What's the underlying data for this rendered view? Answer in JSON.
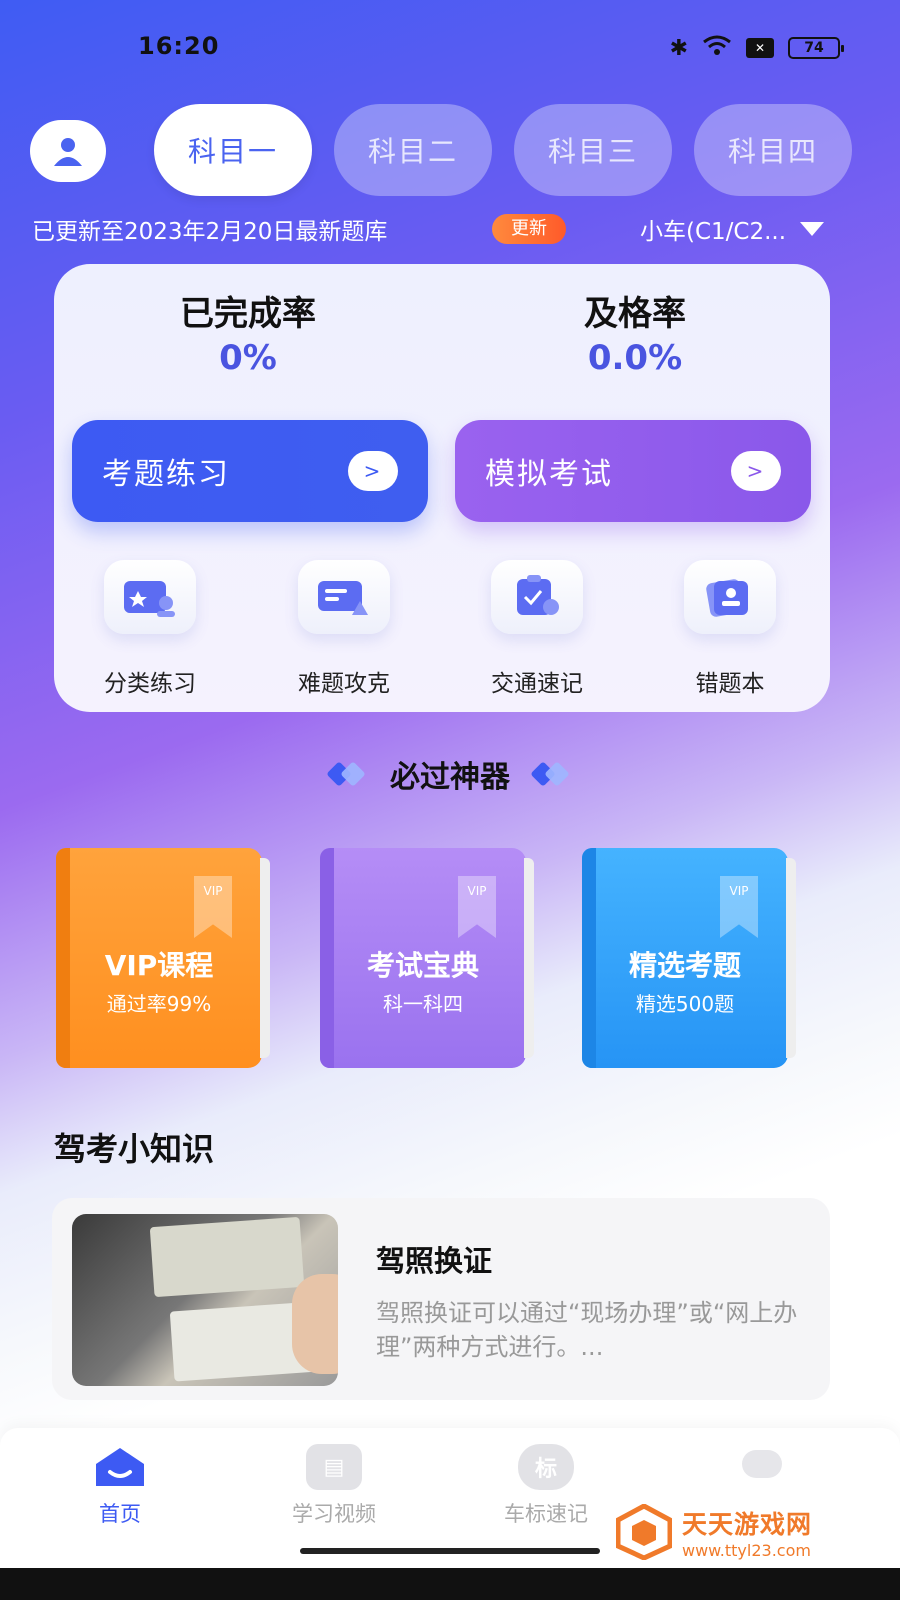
{
  "status": {
    "time": "16:20",
    "battery": "74",
    "icons": [
      "bluetooth-icon",
      "wifi-icon",
      "sim-icon",
      "battery-icon"
    ]
  },
  "header": {
    "avatar_icon": "user-icon",
    "tabs": [
      {
        "label": "科目一",
        "active": true
      },
      {
        "label": "科目二",
        "active": false
      },
      {
        "label": "科目三",
        "active": false
      },
      {
        "label": "科目四",
        "active": false
      }
    ],
    "update_text": "已更新至2023年2月20日最新题库",
    "update_badge": "更新",
    "car_type": "小车(C1/C2..."
  },
  "stats": {
    "completion_label": "已完成率",
    "completion_value": "0%",
    "pass_label": "及格率",
    "pass_value": "0.0%"
  },
  "actions": {
    "practice_label": "考题练习",
    "exam_label": "模拟考试",
    "arrow": ">"
  },
  "tools": [
    {
      "label": "分类练习",
      "icon": "category-icon"
    },
    {
      "label": "难题攻克",
      "icon": "difficult-icon"
    },
    {
      "label": "交通速记",
      "icon": "traffic-icon"
    },
    {
      "label": "错题本",
      "icon": "mistake-book-icon"
    }
  ],
  "section": {
    "title": "必过神器"
  },
  "books": [
    {
      "title": "VIP课程",
      "subtitle": "通过率99%",
      "tag": "VIP",
      "color": "#ff9a2a"
    },
    {
      "title": "考试宝典",
      "subtitle": "科一科四",
      "tag": "VIP",
      "color": "#a57ff2"
    },
    {
      "title": "精选考题",
      "subtitle": "精选500题",
      "tag": "VIP",
      "color": "#37a6fb"
    }
  ],
  "tips": {
    "heading": "驾考小知识",
    "article_title": "驾照换证",
    "article_desc": "驾照换证可以通过“现场办理”或“网上办理”两种方式进行。..."
  },
  "nav": {
    "items": [
      {
        "label": "首页",
        "icon": "home-icon",
        "active": true
      },
      {
        "label": "学习视频",
        "icon": "video-icon",
        "active": false
      },
      {
        "label": "车标速记",
        "icon": "car-badge-icon",
        "active": false
      },
      {
        "label": "",
        "icon": "profile-icon",
        "active": false
      }
    ],
    "badge_glyph": "标",
    "active_color": "#3d5af3"
  },
  "watermark": {
    "title": "天天游戏网",
    "url": "www.ttyl23.com"
  }
}
